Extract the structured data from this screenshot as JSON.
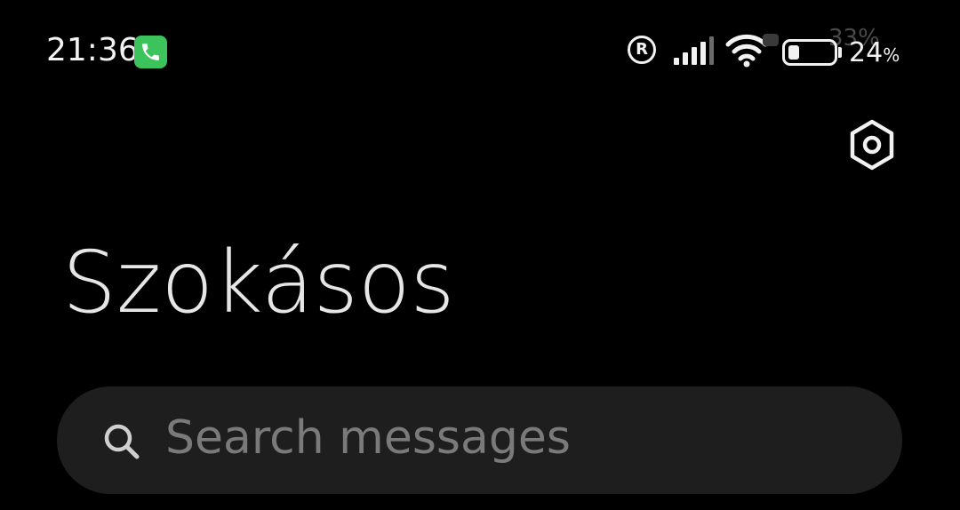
{
  "status_bar": {
    "time": "21:36",
    "roaming_label": "R",
    "battery_percent": "24",
    "battery_pct_sign": "%",
    "battery_level": 0.24,
    "ghost_percent": "33%"
  },
  "header": {
    "title": "Szokásos"
  },
  "search": {
    "placeholder": "Search messages"
  },
  "colors": {
    "background": "#000000",
    "call_badge": "#3cc35c",
    "search_bg": "#1e1e1e",
    "placeholder": "#7a7a7a"
  },
  "icons": {
    "call": "phone-icon",
    "roaming": "roaming-icon",
    "signal": "signal-icon",
    "wifi": "wifi-icon",
    "battery": "battery-icon",
    "settings": "settings-icon",
    "search": "search-icon"
  }
}
